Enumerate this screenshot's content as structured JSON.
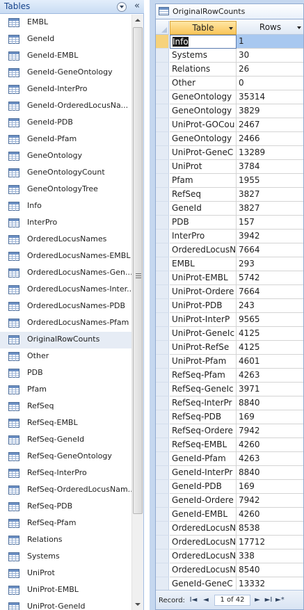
{
  "nav": {
    "title": "Tables",
    "menu_icon": "chevron-down-circle-icon",
    "collapse_icon": "double-chevron-left-icon",
    "collapse_glyph": "«",
    "items": [
      {
        "label": "EMBL"
      },
      {
        "label": "GeneId"
      },
      {
        "label": "GeneId-EMBL"
      },
      {
        "label": "GeneId-GeneOntology"
      },
      {
        "label": "GeneId-InterPro"
      },
      {
        "label": "GeneId-OrderedLocusNa..."
      },
      {
        "label": "GeneId-PDB"
      },
      {
        "label": "GeneId-Pfam"
      },
      {
        "label": "GeneOntology"
      },
      {
        "label": "GeneOntologyCount"
      },
      {
        "label": "GeneOntologyTree"
      },
      {
        "label": "Info"
      },
      {
        "label": "InterPro"
      },
      {
        "label": "OrderedLocusNames"
      },
      {
        "label": "OrderedLocusNames-EMBL"
      },
      {
        "label": "OrderedLocusNames-Gen..."
      },
      {
        "label": "OrderedLocusNames-Inter..."
      },
      {
        "label": "OrderedLocusNames-PDB"
      },
      {
        "label": "OrderedLocusNames-Pfam"
      },
      {
        "label": "OriginalRowCounts",
        "selected": true
      },
      {
        "label": "Other"
      },
      {
        "label": "PDB"
      },
      {
        "label": "Pfam"
      },
      {
        "label": "RefSeq"
      },
      {
        "label": "RefSeq-EMBL"
      },
      {
        "label": "RefSeq-GeneId"
      },
      {
        "label": "RefSeq-GeneOntology"
      },
      {
        "label": "RefSeq-InterPro"
      },
      {
        "label": "RefSeq-OrderedLocusNam..."
      },
      {
        "label": "RefSeq-PDB"
      },
      {
        "label": "RefSeq-Pfam"
      },
      {
        "label": "Relations"
      },
      {
        "label": "Systems"
      },
      {
        "label": "UniProt"
      },
      {
        "label": "UniProt-EMBL"
      },
      {
        "label": "UniProt-GeneId"
      }
    ]
  },
  "document": {
    "tab_label": "OriginalRowCounts",
    "columns": [
      "Table",
      "Rows"
    ],
    "rows": [
      [
        "Info",
        "1"
      ],
      [
        "Systems",
        "30"
      ],
      [
        "Relations",
        "26"
      ],
      [
        "Other",
        "0"
      ],
      [
        "GeneOntology",
        "35314"
      ],
      [
        "GeneOntology",
        "3829"
      ],
      [
        "UniProt-GOCou",
        "2467"
      ],
      [
        "GeneOntology",
        "2466"
      ],
      [
        "UniProt-GeneC",
        "13289"
      ],
      [
        "UniProt",
        "3784"
      ],
      [
        "Pfam",
        "1955"
      ],
      [
        "RefSeq",
        "3827"
      ],
      [
        "GeneId",
        "3827"
      ],
      [
        "PDB",
        "157"
      ],
      [
        "InterPro",
        "3942"
      ],
      [
        "OrderedLocusN",
        "7664"
      ],
      [
        "EMBL",
        "293"
      ],
      [
        "UniProt-EMBL",
        "5742"
      ],
      [
        "UniProt-Ordere",
        "7664"
      ],
      [
        "UniProt-PDB",
        "243"
      ],
      [
        "UniProt-InterP",
        "9565"
      ],
      [
        "UniProt-GeneIc",
        "4125"
      ],
      [
        "UniProt-RefSe",
        "4125"
      ],
      [
        "UniProt-Pfam",
        "4601"
      ],
      [
        "RefSeq-Pfam",
        "4263"
      ],
      [
        "RefSeq-GeneIc",
        "3971"
      ],
      [
        "RefSeq-InterPr",
        "8840"
      ],
      [
        "RefSeq-PDB",
        "169"
      ],
      [
        "RefSeq-Ordere",
        "7942"
      ],
      [
        "RefSeq-EMBL",
        "4260"
      ],
      [
        "GeneId-Pfam",
        "4263"
      ],
      [
        "GeneId-InterPr",
        "8840"
      ],
      [
        "GeneId-PDB",
        "169"
      ],
      [
        "GeneId-Ordere",
        "7942"
      ],
      [
        "GeneId-EMBL",
        "4260"
      ],
      [
        "OrderedLocusN",
        "8538"
      ],
      [
        "OrderedLocusN",
        "17712"
      ],
      [
        "OrderedLocusN",
        "338"
      ],
      [
        "OrderedLocusN",
        "8540"
      ],
      [
        "GeneId-GeneC",
        "13332"
      ]
    ],
    "current_row": 0
  },
  "record_nav": {
    "label": "Record:",
    "position": "1 of 42",
    "first_glyph": "I◄",
    "prev_glyph": "◄",
    "next_glyph": "►",
    "last_glyph": "►I",
    "new_glyph": "►*",
    "filter_glyph": "No"
  },
  "colors": {
    "accent_header": "#f9c55a",
    "selection": "#a8c8f0",
    "nav_title": "#15428b"
  }
}
